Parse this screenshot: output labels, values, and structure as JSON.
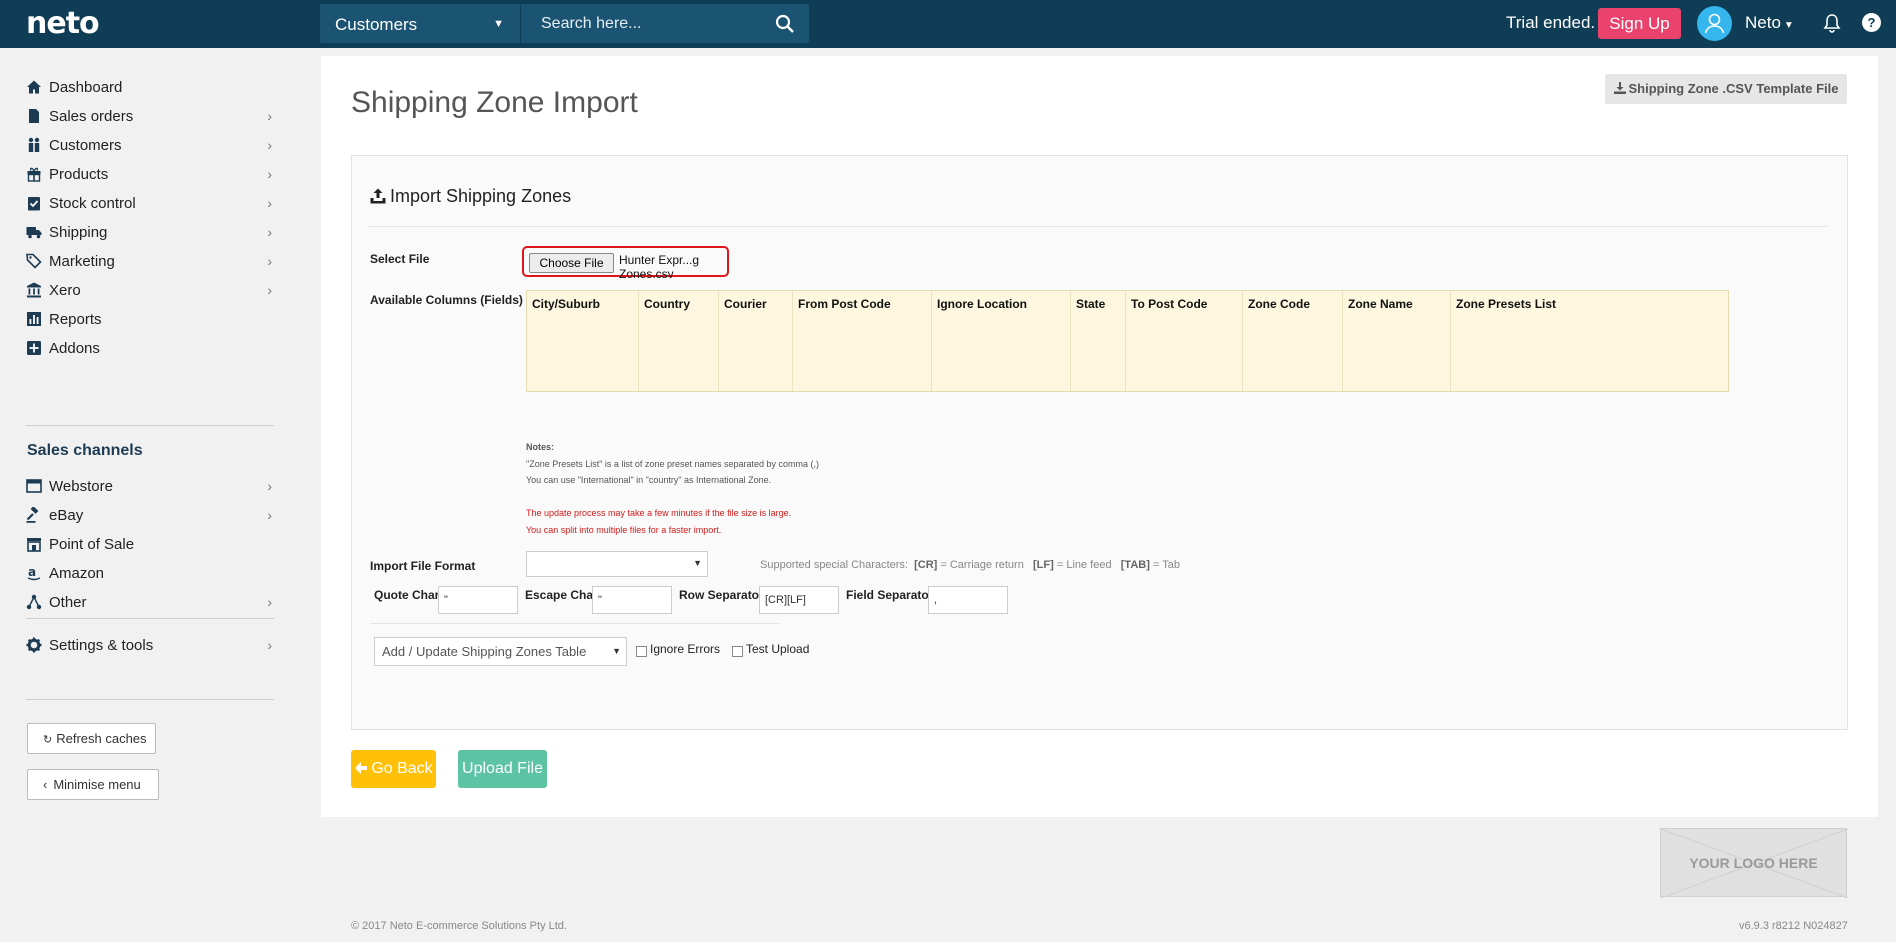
{
  "brand": {
    "logo": "neto"
  },
  "search": {
    "scope": "Customers",
    "placeholder": "Search here..."
  },
  "header": {
    "trial": "Trial ended.",
    "signup": "Sign Up",
    "user": "Neto",
    "help": "?"
  },
  "sidebar": {
    "items": [
      {
        "label": "Dashboard",
        "icon": "home-icon",
        "chevron": false
      },
      {
        "label": "Sales orders",
        "icon": "file-icon",
        "chevron": true
      },
      {
        "label": "Customers",
        "icon": "users-icon",
        "chevron": true
      },
      {
        "label": "Products",
        "icon": "gift-icon",
        "chevron": true
      },
      {
        "label": "Stock control",
        "icon": "clipboard-check-icon",
        "chevron": true
      },
      {
        "label": "Shipping",
        "icon": "truck-icon",
        "chevron": true
      },
      {
        "label": "Marketing",
        "icon": "tags-icon",
        "chevron": true
      },
      {
        "label": "Xero",
        "icon": "bank-icon",
        "chevron": true
      },
      {
        "label": "Reports",
        "icon": "bar-chart-icon",
        "chevron": false
      },
      {
        "label": "Addons",
        "icon": "plus-square-icon",
        "chevron": false
      }
    ],
    "channels_heading": "Sales channels",
    "channels": [
      {
        "label": "Webstore",
        "icon": "browser-icon",
        "chevron": true
      },
      {
        "label": "eBay",
        "icon": "gavel-icon",
        "chevron": true
      },
      {
        "label": "Point of Sale",
        "icon": "storefront-icon",
        "chevron": false
      },
      {
        "label": "Amazon",
        "icon": "amazon-icon",
        "chevron": false
      },
      {
        "label": "Other",
        "icon": "share-icon",
        "chevron": true
      }
    ],
    "settings": {
      "label": "Settings & tools",
      "icon": "cog-icon",
      "chevron": true
    },
    "refresh": "Refresh caches",
    "minimise": "Minimise menu"
  },
  "page": {
    "title": "Shipping Zone Import",
    "template_button": "Shipping Zone .CSV Template File",
    "panel_title": "Import Shipping Zones",
    "select_file_label": "Select File",
    "choose_file": "Choose File",
    "file_name": "Hunter Expr...g Zones.csv",
    "available_label": "Available Columns (Fields)",
    "columns": [
      "City/Suburb",
      "Country",
      "Courier",
      "From Post Code",
      "Ignore Location",
      "State",
      "To Post Code",
      "Zone Code",
      "Zone Name",
      "Zone Presets List"
    ],
    "notes_heading": "Notes:",
    "note1": "\"Zone Presets List\" is a list of zone preset names separated by comma (,)",
    "note2": "You can use \"International\" in \"country\" as International Zone.",
    "warn1": "The update process may take a few minutes if the file size is large.",
    "warn2": "You can split into multiple files for a faster import.",
    "format_label": "Import File Format",
    "format_value": "",
    "special_label": "Supported special Characters:",
    "special_cr_code": "[CR]",
    "special_cr_text": "= Carriage return",
    "special_lf_code": "[LF]",
    "special_lf_text": "= Line feed",
    "special_tab_code": "[TAB]",
    "special_tab_text": "= Tab",
    "quote_label": "Quote Char:",
    "quote_value": "\"",
    "escape_label": "Escape Char:",
    "escape_value": "\"",
    "row_sep_label": "Row Separator:",
    "row_sep_value": "[CR][LF]",
    "field_sep_label": "Field Separator:",
    "field_sep_value": ",",
    "action_value": "Add / Update Shipping Zones Table",
    "ignore_errors": "Ignore Errors",
    "test_upload": "Test Upload",
    "go_back": "Go Back",
    "upload": "Upload File"
  },
  "footer": {
    "logo_placeholder": "YOUR LOGO HERE",
    "copyright": "© 2017 Neto E-commerce Solutions Pty Ltd.",
    "version": "v6.9.3 r8212 N024827"
  },
  "colors": {
    "topbar": "#0f3d56",
    "signup": "#e9426c",
    "go_back": "#ffc107",
    "upload": "#5cc3a5",
    "highlight": "#e0161c"
  }
}
